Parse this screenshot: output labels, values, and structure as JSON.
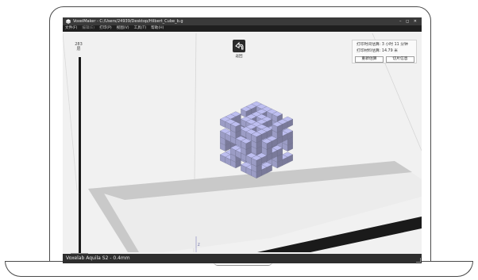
{
  "window": {
    "title": "VoxelMaker - C:/Users/24939/Desktop/Hilbert_Cube_b.g",
    "controls": "– ◻ ✕"
  },
  "menu": [
    {
      "label": "文件(F)",
      "enabled": true
    },
    {
      "label": "编辑(E)",
      "enabled": false
    },
    {
      "label": "打印(P)",
      "enabled": true
    },
    {
      "label": "视图(V)",
      "enabled": true
    },
    {
      "label": "工具(T)",
      "enabled": true
    },
    {
      "label": "帮助(H)",
      "enabled": true
    }
  ],
  "layer_slider": {
    "max_layer": "283",
    "unit": "层",
    "current_layer": "283"
  },
  "return_button": {
    "label": "返回",
    "icon": "return-arrow-icon"
  },
  "print_info": {
    "time_estimate": "打印时间估算: 3 小时 11 分钟",
    "material_estimate": "打印材料估算: 14.79 米",
    "recalc_button": "重新估算",
    "slice_info_button": "切片信息"
  },
  "scene": {
    "model_color": "#a9aad6",
    "bed_border_color": "#c8c8c8",
    "z_axis_label": "Z"
  },
  "status": {
    "printer": "Voxelab Aquila S2 - 0.4mm"
  }
}
